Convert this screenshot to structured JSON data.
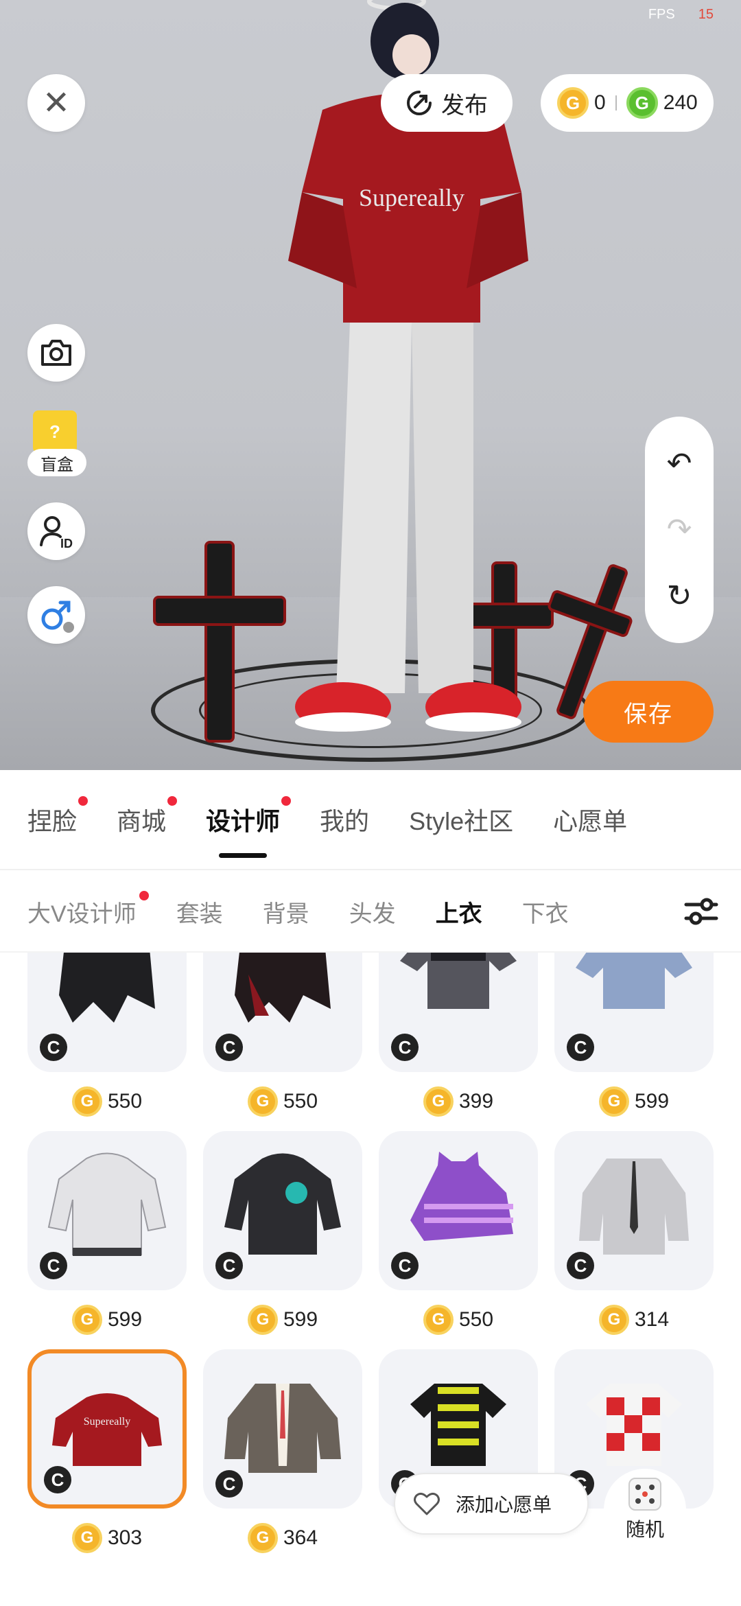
{
  "fps": {
    "label": "FPS",
    "value": "15"
  },
  "top_bar": {
    "close_icon": "✕",
    "publish_label": "发布",
    "gold_coin_symbol": "G",
    "gold_balance": "0",
    "green_coin_symbol": "G",
    "green_balance": "240"
  },
  "left_tools": {
    "blindbox_label": "盲盒",
    "blindbox_box_glyph": "?"
  },
  "history": {
    "undo": "↶",
    "redo": "↷",
    "reset": "↻"
  },
  "save_label": "保存",
  "main_tabs": [
    {
      "label": "捏脸",
      "dot": true
    },
    {
      "label": "商城",
      "dot": true
    },
    {
      "label": "设计师",
      "dot": true,
      "active": true
    },
    {
      "label": "我的",
      "dot": false
    },
    {
      "label": "Style社区",
      "dot": false
    },
    {
      "label": "心愿单",
      "dot": false
    }
  ],
  "sub_tabs": [
    {
      "label": "大V设计师",
      "dot": true
    },
    {
      "label": "套装"
    },
    {
      "label": "背景"
    },
    {
      "label": "头发"
    },
    {
      "label": "上衣",
      "active": true
    },
    {
      "label": "下衣"
    }
  ],
  "items": [
    {
      "price": "550",
      "badge": "C"
    },
    {
      "price": "550",
      "badge": "C"
    },
    {
      "price": "399",
      "badge": "C"
    },
    {
      "price": "599",
      "badge": "C"
    },
    {
      "price": "599",
      "badge": "C"
    },
    {
      "price": "599",
      "badge": "C"
    },
    {
      "price": "550",
      "badge": "C"
    },
    {
      "price": "314",
      "badge": "C"
    },
    {
      "price": "303",
      "badge": "C",
      "selected": true
    },
    {
      "price": "364",
      "badge": "C"
    },
    {
      "price": "",
      "badge": "C"
    },
    {
      "price": "",
      "badge": "C"
    }
  ],
  "wishlist_label": "添加心愿单",
  "random_label": "随机",
  "colors": {
    "accent": "#f77a16",
    "selected_border": "#f28a26",
    "dot": "#f0283c",
    "gold": "#f5b52a",
    "green": "#5abf2f"
  }
}
